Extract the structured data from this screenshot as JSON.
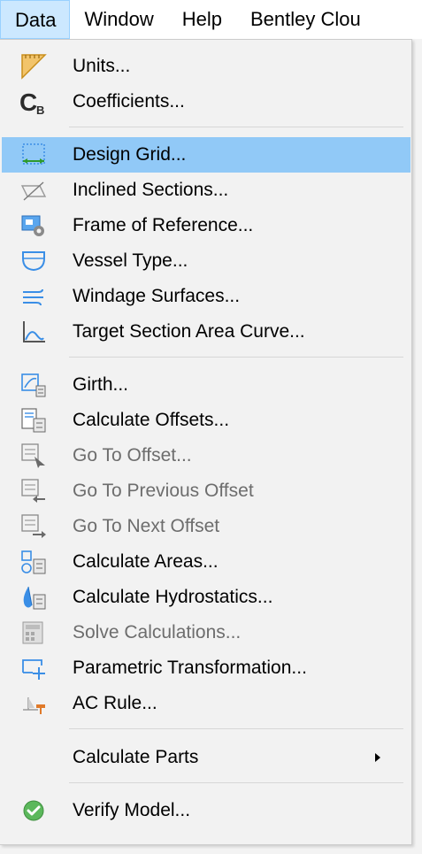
{
  "menubar": [
    "Data",
    "Window",
    "Help",
    "Bentley Clou"
  ],
  "menu": {
    "units": "Units...",
    "coefficients": "Coefficients...",
    "design_grid": "Design Grid...",
    "inclined_sections": "Inclined Sections...",
    "frame_of_reference": "Frame of Reference...",
    "vessel_type": "Vessel Type...",
    "windage_surfaces": "Windage Surfaces...",
    "target_section_area_curve": "Target Section Area Curve...",
    "girth": "Girth...",
    "calculate_offsets": "Calculate Offsets...",
    "go_to_offset": "Go To Offset...",
    "go_to_previous_offset": "Go To Previous Offset",
    "go_to_next_offset": "Go To Next Offset",
    "calculate_areas": "Calculate Areas...",
    "calculate_hydrostatics": "Calculate Hydrostatics...",
    "solve_calculations": "Solve Calculations...",
    "parametric_transformation": "Parametric Transformation...",
    "ac_rule": "AC Rule...",
    "calculate_parts": "Calculate Parts",
    "verify_model": "Verify Model..."
  },
  "icons": {
    "coefficients_letter": "C",
    "coefficients_sub": "B"
  },
  "colors": {
    "highlight": "#91c9f7",
    "menubar_active": "#cce8ff",
    "disabled_text": "#6d6d6d",
    "icon_blue": "#3a8ee6",
    "icon_green": "#2e9a2e"
  }
}
